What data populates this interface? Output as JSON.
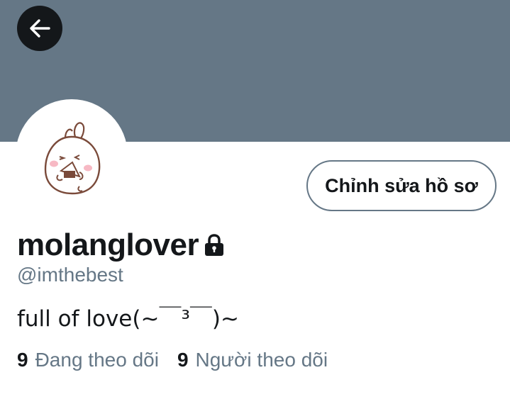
{
  "header": {
    "back_icon": "arrow-left-icon",
    "banner_color": "#657786"
  },
  "profile": {
    "avatar_icon": "molang-bunny-avatar",
    "edit_button_label": "Chỉnh sửa hồ sơ",
    "display_name": "molanglover",
    "lock_icon": "lock-icon",
    "handle": "@imthebest",
    "bio": "full of love(~￣³￣)~"
  },
  "stats": {
    "following_count": "9",
    "following_label": "Đang theo dõi",
    "followers_count": "9",
    "followers_label": "Người theo dõi"
  },
  "colors": {
    "text_primary": "#14171a",
    "text_secondary": "#657786"
  }
}
